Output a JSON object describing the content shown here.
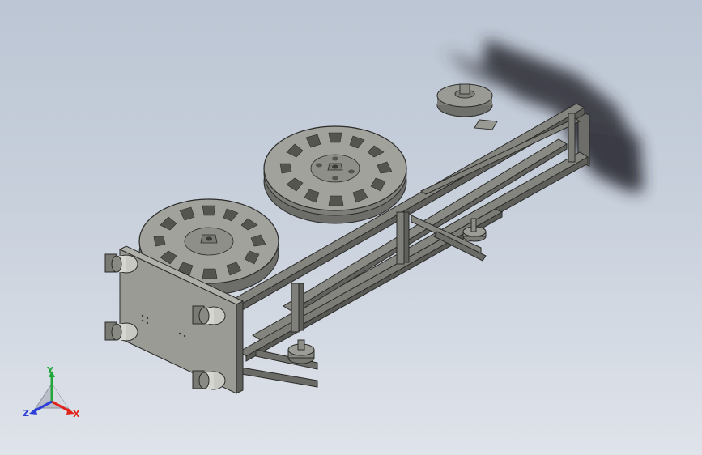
{
  "viewport": {
    "background_top": "#bcc6d4",
    "background_bottom": "#dfe3ea",
    "model_color": "#8f8f8a",
    "model_dark": "#5a5a56",
    "shadow_color": "#2a2b30"
  },
  "triad": {
    "x_label": "X",
    "y_label": "Y",
    "z_label": "Z",
    "x_color": "#e0241a",
    "y_color": "#22a83a",
    "z_color": "#2d3fd6"
  }
}
